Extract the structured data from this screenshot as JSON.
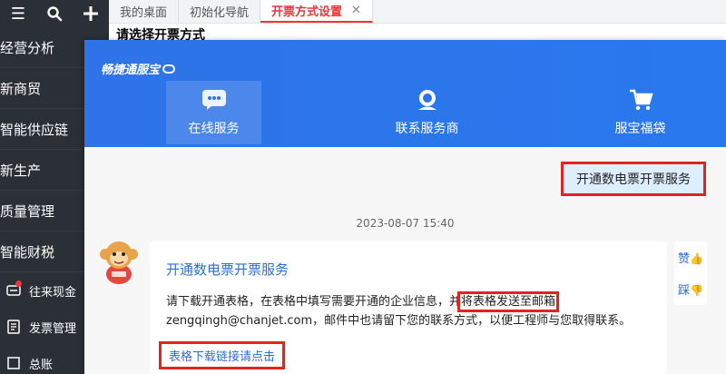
{
  "sidebar": {
    "top_icons": [
      "menu-icon",
      "search-icon",
      "plus-icon"
    ],
    "top_glyphs": [
      "☰",
      "⚲",
      "✚"
    ],
    "items": [
      {
        "label": "经营分析"
      },
      {
        "label": "新商贸"
      },
      {
        "label": "智能供应链"
      },
      {
        "label": "新生产"
      },
      {
        "label": "质量管理"
      },
      {
        "label": "智能财税"
      }
    ],
    "sub_items": [
      {
        "label": "往来现金",
        "icon": "cash-icon",
        "badge": true
      },
      {
        "label": "发票管理",
        "icon": "invoice-icon",
        "badge": false
      },
      {
        "label": "总账",
        "icon": "ledger-icon",
        "badge": false
      }
    ]
  },
  "tabs": [
    {
      "label": "我的桌面",
      "active": false
    },
    {
      "label": "初始化导航",
      "active": false
    },
    {
      "label": "开票方式设置",
      "active": true,
      "close": "✕"
    }
  ],
  "prompt": "请选择开票方式",
  "service": {
    "logo": "畅捷通服宝",
    "nav": [
      {
        "label": "在线服务",
        "icon": "chat-bubble-icon",
        "active": true
      },
      {
        "label": "联系服务商",
        "icon": "agent-icon",
        "active": false
      },
      {
        "label": "服宝福袋",
        "icon": "shopping-cart-icon",
        "active": false
      }
    ],
    "user_message": "开通数电票开票服务",
    "timestamp": "2023-08-07 15:40",
    "bot": {
      "title": "开通数电票开票服务",
      "body_pre": "请下载开通表格，在表格中填写需要开通的企业信息，并",
      "body_highlight": "将表格发送至邮箱",
      "body_post": " zengqingh@chanjet.com，邮件中也请留下您的联系方式，以便工程师与您取得联系。",
      "link": "表格下载链接请点击"
    },
    "vote": {
      "like": "赞",
      "dislike": "踩"
    }
  },
  "colors": {
    "accent_red": "#e5221b",
    "brand_blue": "#2e73e8",
    "sidebar_bg": "#2b2f36"
  }
}
